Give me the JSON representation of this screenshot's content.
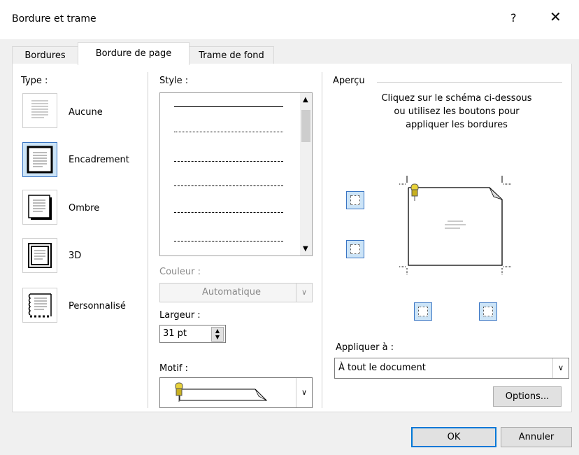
{
  "dialog": {
    "title": "Bordure et trame",
    "help_label": "?",
    "close_label": "✕"
  },
  "tabs": [
    {
      "label": "Bordures",
      "active": false
    },
    {
      "label": "Bordure de page",
      "active": true
    },
    {
      "label": "Trame de fond",
      "active": false
    }
  ],
  "type": {
    "label": "Type :",
    "options": [
      {
        "label": "Aucune",
        "selected": false
      },
      {
        "label": "Encadrement",
        "selected": true
      },
      {
        "label": "Ombre",
        "selected": false
      },
      {
        "label": "3D",
        "selected": false
      },
      {
        "label": "Personnalisé",
        "selected": false
      }
    ]
  },
  "style": {
    "label": "Style :",
    "items": [
      "solid",
      "dotted",
      "dashed-small",
      "dashed",
      "dash-dot",
      "dash-dot-dot"
    ]
  },
  "couleur": {
    "label": "Couleur :",
    "value": "Automatique"
  },
  "largeur": {
    "label": "Largeur :",
    "value": "31 pt"
  },
  "motif": {
    "label": "Motif :"
  },
  "apercu": {
    "label": "Aperçu",
    "instructions": "Cliquez sur le schéma ci-dessous ou utilisez les boutons pour appliquer les bordures"
  },
  "appliquer": {
    "label": "Appliquer à :",
    "value": "À tout le document"
  },
  "buttons": {
    "options": "Options...",
    "ok": "OK",
    "cancel": "Annuler"
  },
  "colors": {
    "accent": "#0078d7",
    "selection_bg": "#cce4f7"
  }
}
